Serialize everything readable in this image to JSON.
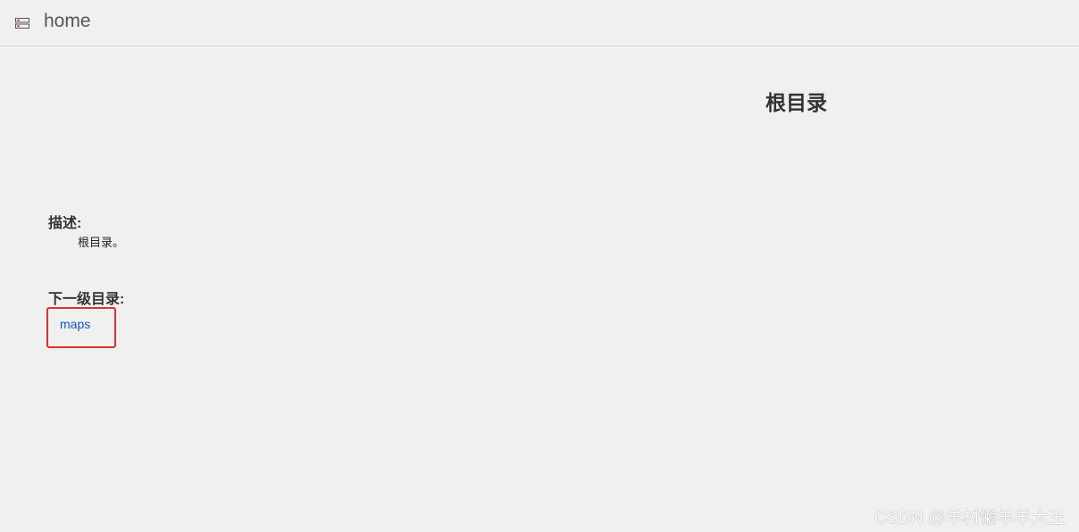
{
  "header": {
    "icon": "server-icon",
    "title": "home"
  },
  "main": {
    "heading": "根目录",
    "description_label": "描述:",
    "description_text": "根目录。",
    "subdirectories_label": "下一级目录:",
    "subdirectories": [
      {
        "label": "maps"
      }
    ],
    "highlight_color": "#e0322d",
    "link_color": "#1b52c9"
  },
  "watermark": "CSDN @羊村懒羊羊大王"
}
